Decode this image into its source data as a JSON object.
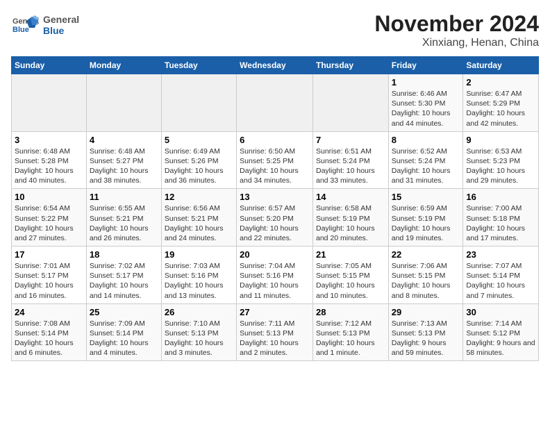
{
  "logo": {
    "general": "General",
    "blue": "Blue"
  },
  "title": "November 2024",
  "subtitle": "Xinxiang, Henan, China",
  "days_of_week": [
    "Sunday",
    "Monday",
    "Tuesday",
    "Wednesday",
    "Thursday",
    "Friday",
    "Saturday"
  ],
  "weeks": [
    [
      {
        "num": "",
        "info": ""
      },
      {
        "num": "",
        "info": ""
      },
      {
        "num": "",
        "info": ""
      },
      {
        "num": "",
        "info": ""
      },
      {
        "num": "",
        "info": ""
      },
      {
        "num": "1",
        "info": "Sunrise: 6:46 AM\nSunset: 5:30 PM\nDaylight: 10 hours and 44 minutes."
      },
      {
        "num": "2",
        "info": "Sunrise: 6:47 AM\nSunset: 5:29 PM\nDaylight: 10 hours and 42 minutes."
      }
    ],
    [
      {
        "num": "3",
        "info": "Sunrise: 6:48 AM\nSunset: 5:28 PM\nDaylight: 10 hours and 40 minutes."
      },
      {
        "num": "4",
        "info": "Sunrise: 6:48 AM\nSunset: 5:27 PM\nDaylight: 10 hours and 38 minutes."
      },
      {
        "num": "5",
        "info": "Sunrise: 6:49 AM\nSunset: 5:26 PM\nDaylight: 10 hours and 36 minutes."
      },
      {
        "num": "6",
        "info": "Sunrise: 6:50 AM\nSunset: 5:25 PM\nDaylight: 10 hours and 34 minutes."
      },
      {
        "num": "7",
        "info": "Sunrise: 6:51 AM\nSunset: 5:24 PM\nDaylight: 10 hours and 33 minutes."
      },
      {
        "num": "8",
        "info": "Sunrise: 6:52 AM\nSunset: 5:24 PM\nDaylight: 10 hours and 31 minutes."
      },
      {
        "num": "9",
        "info": "Sunrise: 6:53 AM\nSunset: 5:23 PM\nDaylight: 10 hours and 29 minutes."
      }
    ],
    [
      {
        "num": "10",
        "info": "Sunrise: 6:54 AM\nSunset: 5:22 PM\nDaylight: 10 hours and 27 minutes."
      },
      {
        "num": "11",
        "info": "Sunrise: 6:55 AM\nSunset: 5:21 PM\nDaylight: 10 hours and 26 minutes."
      },
      {
        "num": "12",
        "info": "Sunrise: 6:56 AM\nSunset: 5:21 PM\nDaylight: 10 hours and 24 minutes."
      },
      {
        "num": "13",
        "info": "Sunrise: 6:57 AM\nSunset: 5:20 PM\nDaylight: 10 hours and 22 minutes."
      },
      {
        "num": "14",
        "info": "Sunrise: 6:58 AM\nSunset: 5:19 PM\nDaylight: 10 hours and 20 minutes."
      },
      {
        "num": "15",
        "info": "Sunrise: 6:59 AM\nSunset: 5:19 PM\nDaylight: 10 hours and 19 minutes."
      },
      {
        "num": "16",
        "info": "Sunrise: 7:00 AM\nSunset: 5:18 PM\nDaylight: 10 hours and 17 minutes."
      }
    ],
    [
      {
        "num": "17",
        "info": "Sunrise: 7:01 AM\nSunset: 5:17 PM\nDaylight: 10 hours and 16 minutes."
      },
      {
        "num": "18",
        "info": "Sunrise: 7:02 AM\nSunset: 5:17 PM\nDaylight: 10 hours and 14 minutes."
      },
      {
        "num": "19",
        "info": "Sunrise: 7:03 AM\nSunset: 5:16 PM\nDaylight: 10 hours and 13 minutes."
      },
      {
        "num": "20",
        "info": "Sunrise: 7:04 AM\nSunset: 5:16 PM\nDaylight: 10 hours and 11 minutes."
      },
      {
        "num": "21",
        "info": "Sunrise: 7:05 AM\nSunset: 5:15 PM\nDaylight: 10 hours and 10 minutes."
      },
      {
        "num": "22",
        "info": "Sunrise: 7:06 AM\nSunset: 5:15 PM\nDaylight: 10 hours and 8 minutes."
      },
      {
        "num": "23",
        "info": "Sunrise: 7:07 AM\nSunset: 5:14 PM\nDaylight: 10 hours and 7 minutes."
      }
    ],
    [
      {
        "num": "24",
        "info": "Sunrise: 7:08 AM\nSunset: 5:14 PM\nDaylight: 10 hours and 6 minutes."
      },
      {
        "num": "25",
        "info": "Sunrise: 7:09 AM\nSunset: 5:14 PM\nDaylight: 10 hours and 4 minutes."
      },
      {
        "num": "26",
        "info": "Sunrise: 7:10 AM\nSunset: 5:13 PM\nDaylight: 10 hours and 3 minutes."
      },
      {
        "num": "27",
        "info": "Sunrise: 7:11 AM\nSunset: 5:13 PM\nDaylight: 10 hours and 2 minutes."
      },
      {
        "num": "28",
        "info": "Sunrise: 7:12 AM\nSunset: 5:13 PM\nDaylight: 10 hours and 1 minute."
      },
      {
        "num": "29",
        "info": "Sunrise: 7:13 AM\nSunset: 5:13 PM\nDaylight: 9 hours and 59 minutes."
      },
      {
        "num": "30",
        "info": "Sunrise: 7:14 AM\nSunset: 5:12 PM\nDaylight: 9 hours and 58 minutes."
      }
    ]
  ]
}
